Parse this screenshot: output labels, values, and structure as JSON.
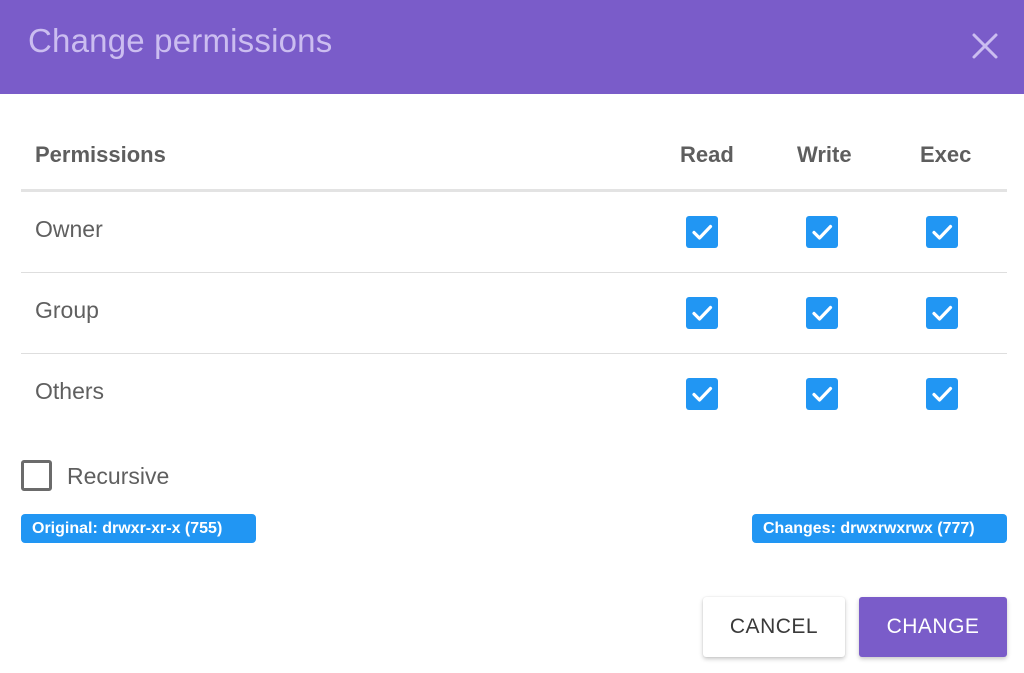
{
  "dialog": {
    "title": "Change permissions",
    "close_icon": "close-icon",
    "accent_color": "#7a5cc9",
    "checkbox_color": "#2196f3"
  },
  "table": {
    "headers": {
      "permissions": "Permissions",
      "read": "Read",
      "write": "Write",
      "exec": "Exec"
    },
    "rows": [
      {
        "label": "Owner",
        "read": true,
        "write": true,
        "exec": true
      },
      {
        "label": "Group",
        "read": true,
        "write": true,
        "exec": true
      },
      {
        "label": "Others",
        "read": true,
        "write": true,
        "exec": true
      }
    ]
  },
  "recursive": {
    "label": "Recursive",
    "checked": false
  },
  "badges": {
    "original": "Original: drwxr-xr-x (755)",
    "changes": "Changes: drwxrwxrwx (777)"
  },
  "buttons": {
    "cancel": "CANCEL",
    "change": "CHANGE"
  }
}
